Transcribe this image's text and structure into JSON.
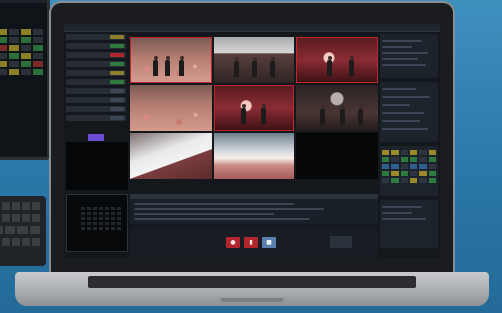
{
  "colors": {
    "tally_program": "#c0272d",
    "tally_preview": "#1f9b3a",
    "accent_purple": "#6c4cd6",
    "control_red": "#b3262c",
    "control_blue": "#5a7fb0"
  },
  "icons": {
    "record": "record-icon",
    "stop": "stop-icon"
  }
}
